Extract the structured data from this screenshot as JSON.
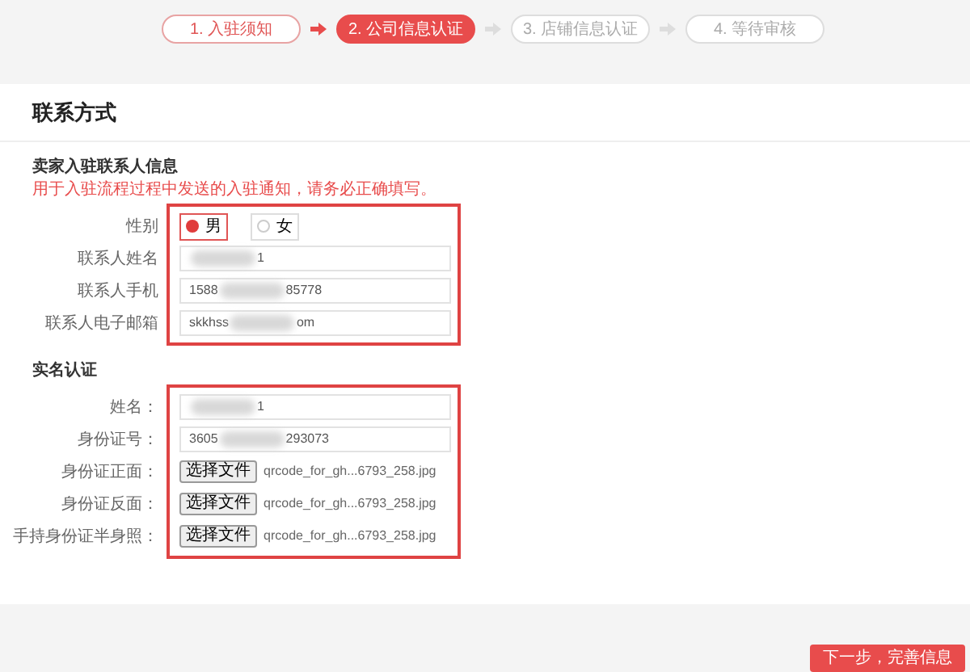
{
  "steps": [
    {
      "label": "1. 入驻须知",
      "kind": "done"
    },
    {
      "label": "2. 公司信息认证",
      "kind": "current"
    },
    {
      "label": "3. 店铺信息认证",
      "kind": "pending"
    },
    {
      "label": "4. 等待审核",
      "kind": "pending"
    }
  ],
  "title": "联系方式",
  "sections": [
    {
      "heading": "卖家入驻联系人信息",
      "note": "用于入驻流程过程中发送的入驻通知，请务必正确填写。",
      "rows": [
        {
          "kind": "radio",
          "label": "性别",
          "options": [
            {
              "label": "男",
              "selected": true
            },
            {
              "label": "女",
              "selected": false
            }
          ]
        },
        {
          "kind": "text",
          "label": "联系人姓名",
          "prefix": "",
          "suffix": "1"
        },
        {
          "kind": "text",
          "label": "联系人手机",
          "prefix": "1588",
          "suffix": "85778"
        },
        {
          "kind": "text",
          "label": "联系人电子邮箱",
          "prefix": "skkhss",
          "suffix": "om"
        }
      ]
    },
    {
      "heading": "实名认证",
      "rows": [
        {
          "kind": "text",
          "label": "姓名：",
          "prefix": "",
          "suffix": "1"
        },
        {
          "kind": "text",
          "label": "身份证号：",
          "prefix": "3605",
          "suffix": "293073"
        },
        {
          "kind": "file",
          "label": "身份证正面：",
          "button": "选择文件",
          "file": "qrcode_for_gh...6793_258.jpg"
        },
        {
          "kind": "file",
          "label": "身份证反面：",
          "button": "选择文件",
          "file": "qrcode_for_gh...6793_258.jpg"
        },
        {
          "kind": "file",
          "label": "手持身份证半身照：",
          "button": "选择文件",
          "file": "qrcode_for_gh...6793_258.jpg"
        }
      ]
    }
  ],
  "next_button": "下一步，完善信息"
}
